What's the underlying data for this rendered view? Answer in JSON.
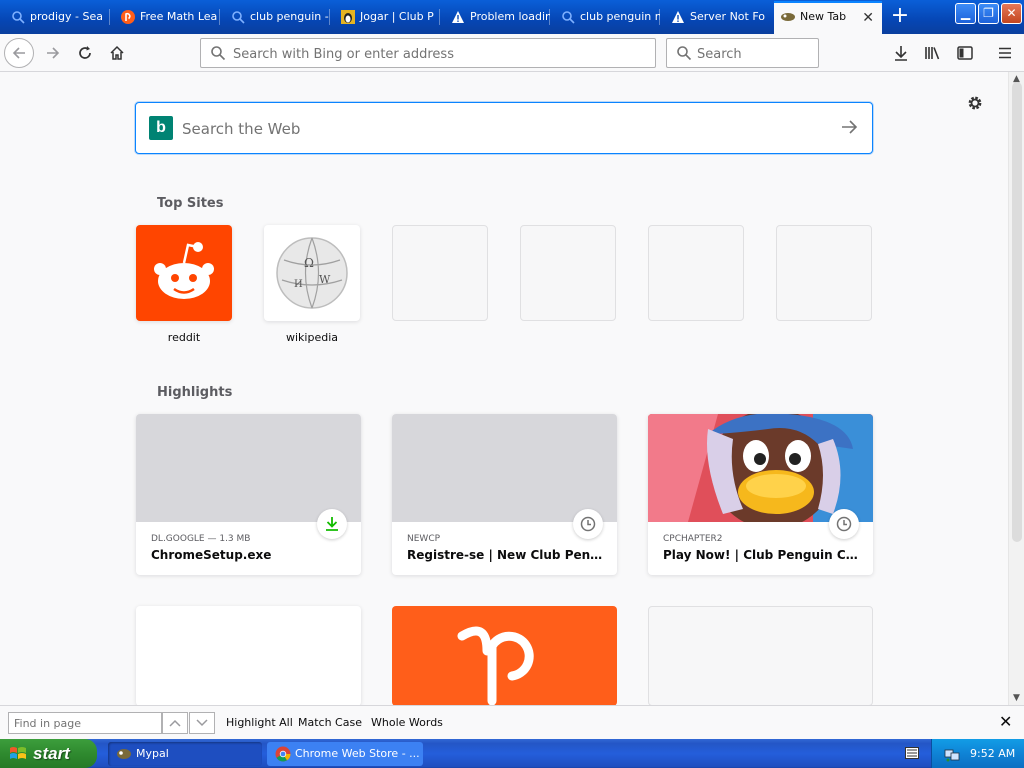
{
  "tabs": [
    {
      "label": "prodigy - Sea",
      "icon": "search-icon"
    },
    {
      "label": "Free Math Lea",
      "icon": "prodigy-icon"
    },
    {
      "label": "club penguin -",
      "icon": "search-icon"
    },
    {
      "label": "Jogar | Club P",
      "icon": "club-penguin-icon"
    },
    {
      "label": "Problem loadin",
      "icon": "warning-icon"
    },
    {
      "label": "club penguin n",
      "icon": "search-icon"
    },
    {
      "label": "Server Not Fo",
      "icon": "warning-icon"
    },
    {
      "label": "New Tab",
      "icon": "newtab-favicon"
    }
  ],
  "toolbar": {
    "url_placeholder": "Search with Bing or enter address",
    "search_placeholder": "Search"
  },
  "newtab": {
    "search_placeholder": "Search the Web",
    "top_sites_heading": "Top Sites",
    "top_sites": [
      {
        "label": "reddit",
        "color": "#ff4500"
      },
      {
        "label": "wikipedia",
        "color": "#ffffff"
      },
      {
        "label": ""
      },
      {
        "label": ""
      },
      {
        "label": ""
      },
      {
        "label": ""
      }
    ],
    "highlights_heading": "Highlights",
    "highlights": [
      {
        "meta": "DL.GOOGLE — 1.3 MB",
        "title": "ChromeSetup.exe",
        "badge": "download-icon"
      },
      {
        "meta": "NEWCP",
        "title": "Registre-se | New Club Penguin",
        "badge": "clock-icon"
      },
      {
        "meta": "CPCHAPTER2",
        "title": "Play Now! | Club Penguin Chapte...",
        "badge": "clock-icon"
      }
    ]
  },
  "findbar": {
    "placeholder": "Find in page",
    "highlight_all": "Highlight All",
    "match_case": "Match Case",
    "whole_words": "Whole Words"
  },
  "taskbar": {
    "start_label": "start",
    "items": [
      {
        "label": "Mypal",
        "icon": "mypal-icon"
      },
      {
        "label": "Chrome Web Store - ...",
        "icon": "chrome-icon"
      }
    ],
    "clock": "9:52 AM"
  },
  "colors": {
    "accent": "#0a84ff",
    "reddit": "#ff4500",
    "bing": "#008373",
    "prodigy_orange": "#ff5e1a",
    "xp_blue": "#245edb",
    "xp_start_green": "#2f8a2f"
  }
}
